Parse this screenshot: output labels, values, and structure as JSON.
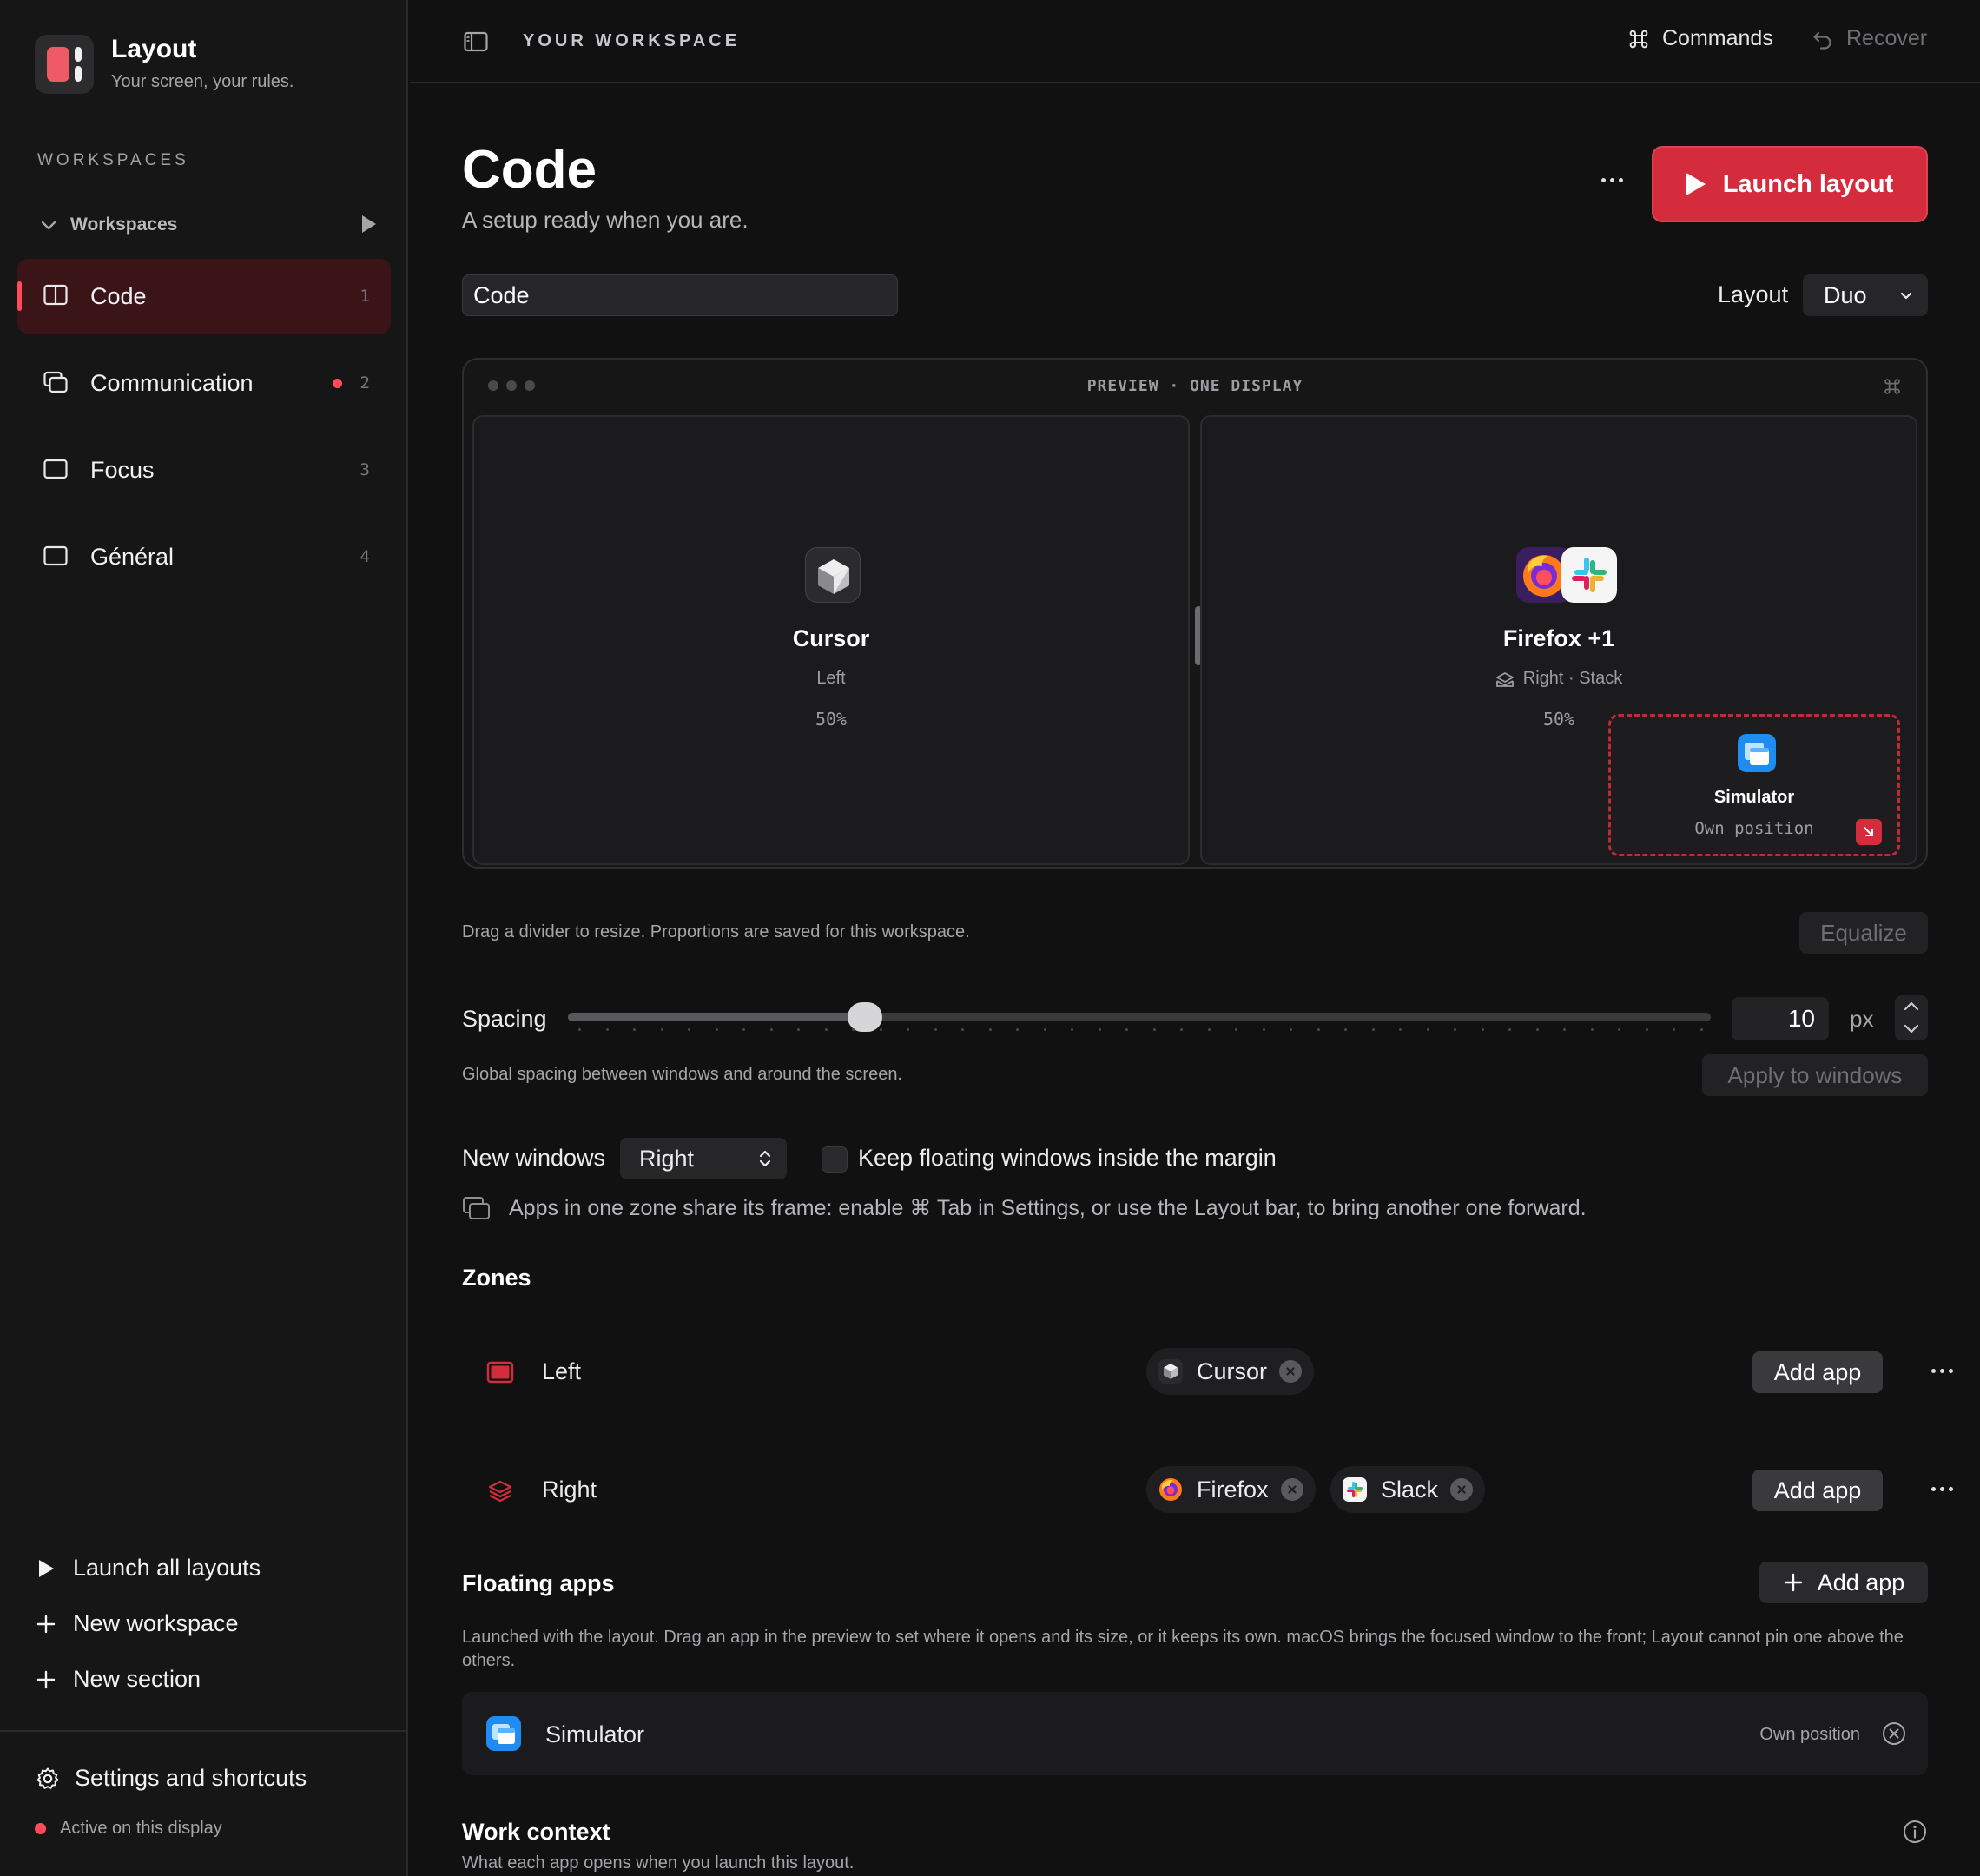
{
  "app": {
    "name": "Layout",
    "tagline": "Your screen, your rules."
  },
  "sidebar": {
    "section_label": "WORKSPACES",
    "group_label": "Workspaces",
    "items": [
      {
        "label": "Code",
        "count": "1",
        "active": true,
        "has_dot": false
      },
      {
        "label": "Communication",
        "count": "2",
        "active": false,
        "has_dot": true
      },
      {
        "label": "Focus",
        "count": "3",
        "active": false,
        "has_dot": false
      },
      {
        "label": "Général",
        "count": "4",
        "active": false,
        "has_dot": false
      }
    ],
    "actions": {
      "launch_all": "Launch all layouts",
      "new_workspace": "New workspace",
      "new_section": "New section"
    },
    "settings": "Settings and shortcuts",
    "status": "Active on this display"
  },
  "topbar": {
    "title": "YOUR WORKSPACE",
    "commands": "Commands",
    "recover": "Recover"
  },
  "header": {
    "title": "Code",
    "subtitle": "A setup ready when you are.",
    "launch": "Launch layout"
  },
  "name_field": {
    "value": "Code"
  },
  "layout_picker": {
    "label": "Layout",
    "value": "Duo"
  },
  "preview": {
    "title": "PREVIEW · ONE DISPLAY",
    "left": {
      "app": "Cursor",
      "position": "Left",
      "percent": "50%"
    },
    "right": {
      "app": "Firefox +1",
      "position": "Right · Stack",
      "percent": "50%"
    },
    "floating": {
      "app": "Simulator",
      "position": "Own position"
    }
  },
  "resize_hint": "Drag a divider to resize. Proportions are saved for this workspace.",
  "equalize": "Equalize",
  "spacing": {
    "label": "Spacing",
    "value": "10",
    "unit": "px",
    "fraction": 0.26,
    "hint": "Global spacing between windows and around the screen.",
    "apply": "Apply to windows"
  },
  "new_windows": {
    "label": "New windows",
    "value": "Right",
    "checkbox_label": "Keep floating windows inside the margin",
    "info": "Apps in one zone share its frame: enable ⌘ Tab in Settings, or use the Layout bar, to bring another one forward."
  },
  "zones": {
    "title": "Zones",
    "rows": [
      {
        "name": "Left",
        "apps": [
          "Cursor"
        ],
        "add": "Add app"
      },
      {
        "name": "Right",
        "apps": [
          "Firefox",
          "Slack"
        ],
        "add": "Add app"
      }
    ]
  },
  "floating_apps": {
    "title": "Floating apps",
    "add": "Add app",
    "description": "Launched with the layout. Drag an app in the preview to set where it opens and its size, or it keeps its own. macOS brings the focused window to the front; Layout cannot pin one above the others.",
    "items": [
      {
        "name": "Simulator",
        "position": "Own position"
      }
    ]
  },
  "work_context": {
    "title": "Work context",
    "subtitle": "What each app opens when you launch this layout."
  },
  "colors": {
    "accent": "#d42b3d",
    "dot": "#ff4b5a",
    "active_bg": "#3a1417"
  }
}
